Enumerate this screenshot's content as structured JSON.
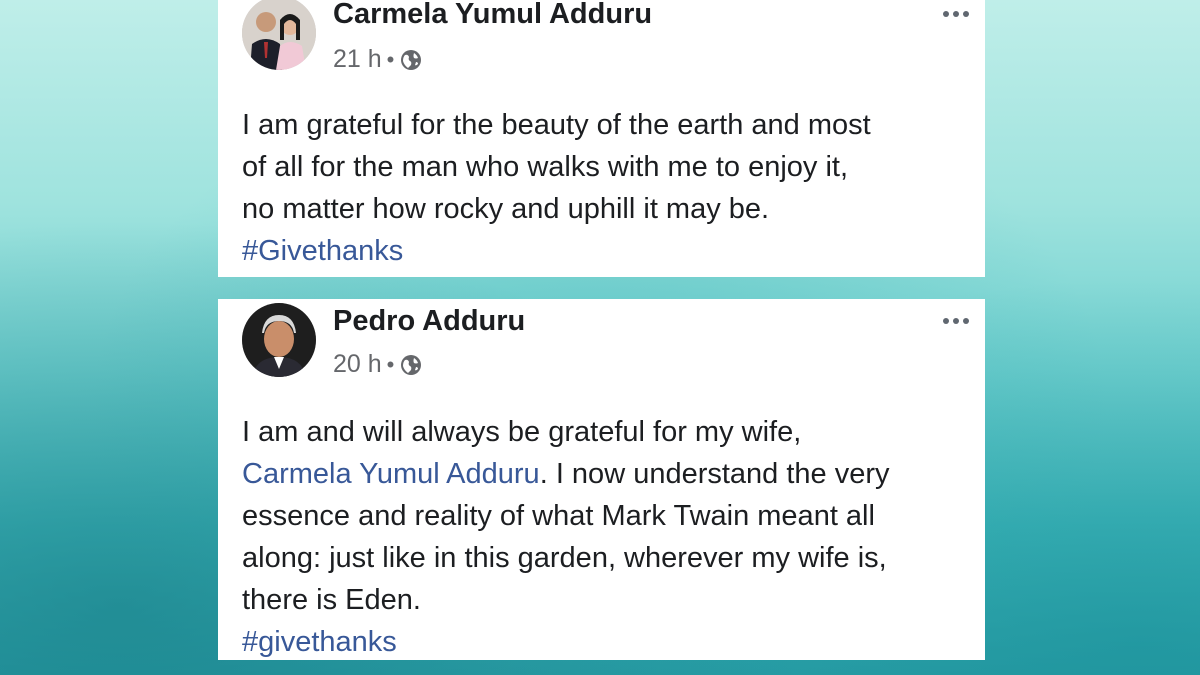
{
  "posts": [
    {
      "author": "Carmela Yumul Adduru",
      "time": "21 h",
      "separator": "•",
      "privacy_icon": "globe-icon",
      "body_lines": [
        "I am grateful for the beauty of the earth and most",
        "of all for the man who walks with me to enjoy it,",
        "no matter how rocky and uphill it may be."
      ],
      "hashtag": "#Givethanks"
    },
    {
      "author": "Pedro Adduru",
      "time": "20 h",
      "separator": "•",
      "privacy_icon": "globe-icon",
      "line1": "I am and will always be grateful for my wife,",
      "mention": "Carmela Yumul Adduru",
      "mention_tail": ". I now understand the very",
      "body_lines": [
        "essence and reality of what Mark Twain meant all",
        "along: just like in this garden, wherever my wife is,",
        "there is Eden."
      ],
      "hashtag": "#givethanks"
    }
  ],
  "colors": {
    "link": "#385898",
    "text": "#1c1e21",
    "meta": "#65676b",
    "background_top": "#bfeee9",
    "background_bottom": "#2a9ea6"
  }
}
